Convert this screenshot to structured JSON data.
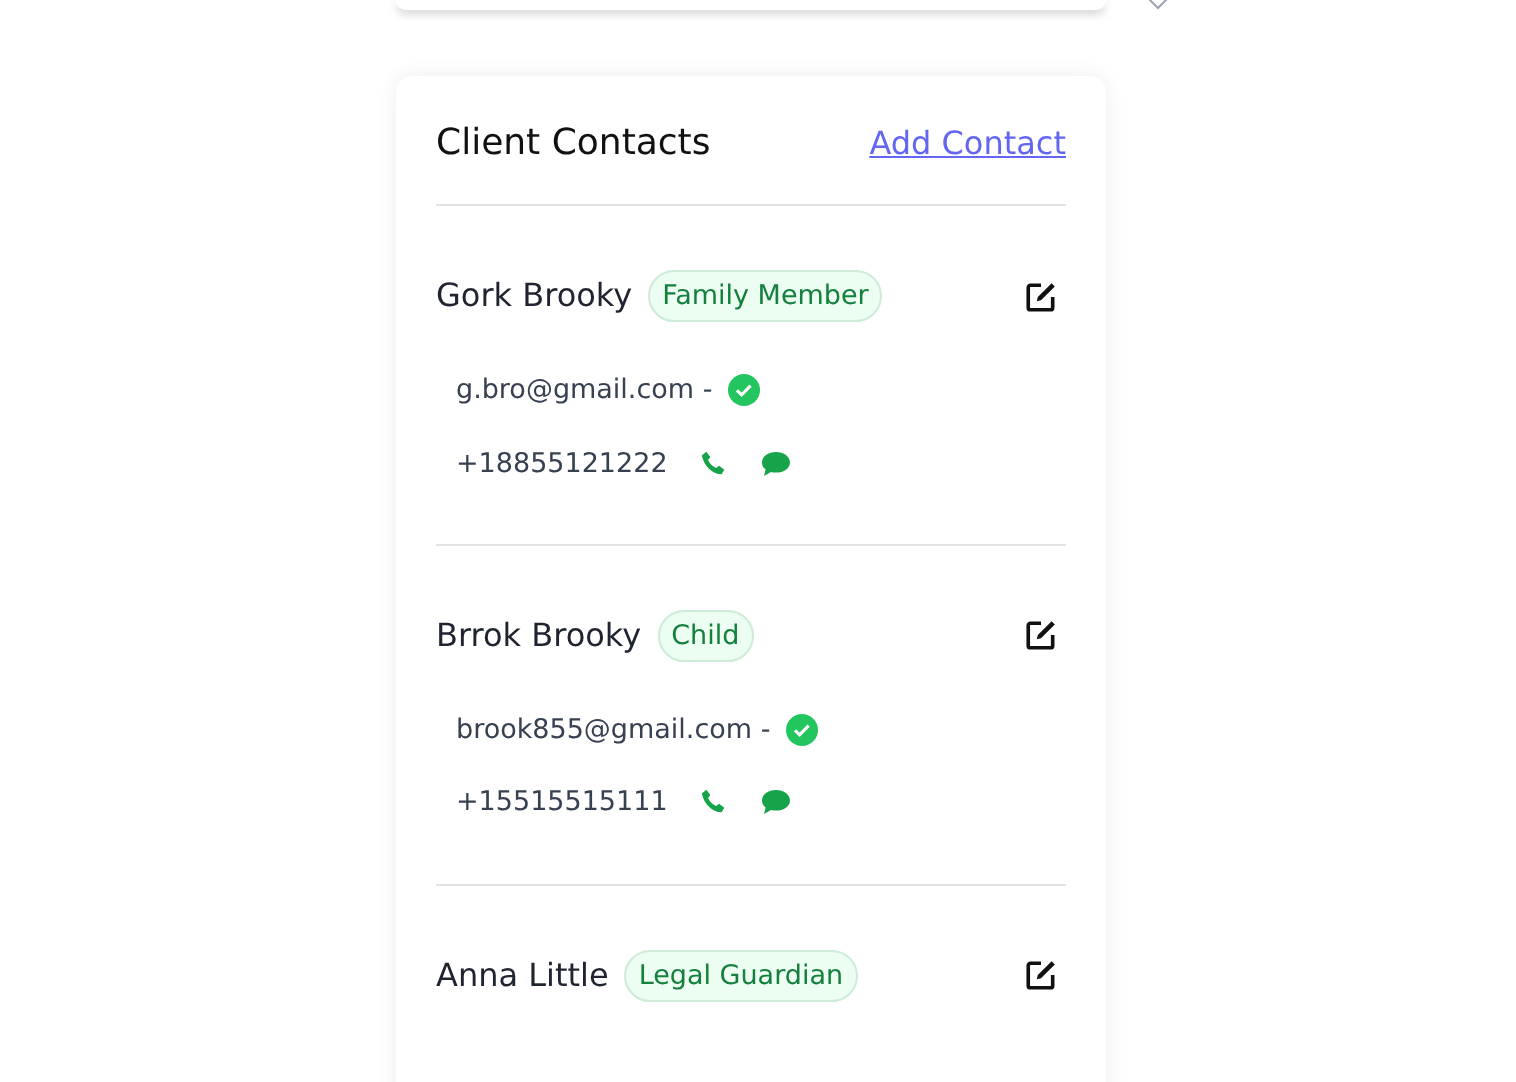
{
  "card": {
    "title": "Client Contacts",
    "add_link": "Add Contact"
  },
  "contacts": [
    {
      "name": "Gork Brooky",
      "relation": "Family Member",
      "email": "g.bro@gmail.com -",
      "email_verified": true,
      "phone": "+18855121222"
    },
    {
      "name": "Brrok Brooky",
      "relation": "Child",
      "email": "brook855@gmail.com -",
      "email_verified": true,
      "phone": "+15515515111"
    },
    {
      "name": "Anna Little",
      "relation": "Legal Guardian"
    }
  ]
}
